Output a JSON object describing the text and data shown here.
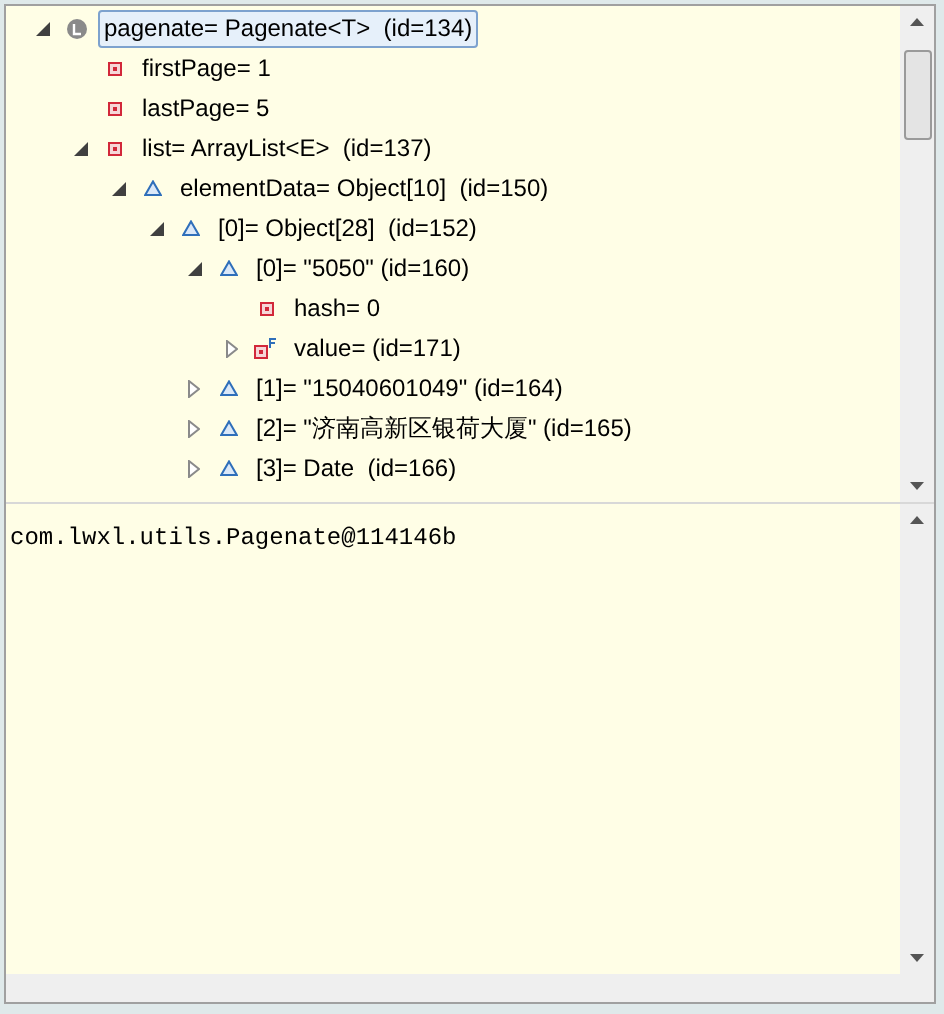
{
  "tree": [
    {
      "label": "pagenate= Pagenate<T>  (id=134)",
      "kind": "local",
      "expanded": true,
      "selected": true,
      "children": [
        {
          "label": "firstPage= 1",
          "kind": "private",
          "selected": false
        },
        {
          "label": "lastPage= 5",
          "kind": "private",
          "selected": false
        },
        {
          "label": "list= ArrayList<E>  (id=137)",
          "kind": "private",
          "expanded": true,
          "selected": false,
          "children": [
            {
              "label": "elementData= Object[10]  (id=150)",
              "kind": "default",
              "expanded": true,
              "selected": false,
              "children": [
                {
                  "label": "[0]= Object[28]  (id=152)",
                  "kind": "default",
                  "expanded": true,
                  "selected": false,
                  "children": [
                    {
                      "label": "[0]= \"5050\" (id=160)",
                      "kind": "default",
                      "expanded": true,
                      "selected": false,
                      "children": [
                        {
                          "label": "hash= 0",
                          "kind": "private",
                          "selected": false
                        },
                        {
                          "label": "value= (id=171)",
                          "kind": "final",
                          "expanded": false,
                          "selected": false
                        }
                      ]
                    },
                    {
                      "label": "[1]= \"15040601049\" (id=164)",
                      "kind": "default",
                      "expanded": false,
                      "selected": false
                    },
                    {
                      "label": "[2]= \"济南高新区银荷大厦\" (id=165)",
                      "kind": "default",
                      "expanded": false,
                      "selected": false
                    },
                    {
                      "label": "[3]= Date  (id=166)",
                      "kind": "default",
                      "expanded": false,
                      "selected": false
                    }
                  ]
                }
              ]
            }
          ]
        }
      ]
    }
  ],
  "detail": "com.lwxl.utils.Pagenate@114146b"
}
